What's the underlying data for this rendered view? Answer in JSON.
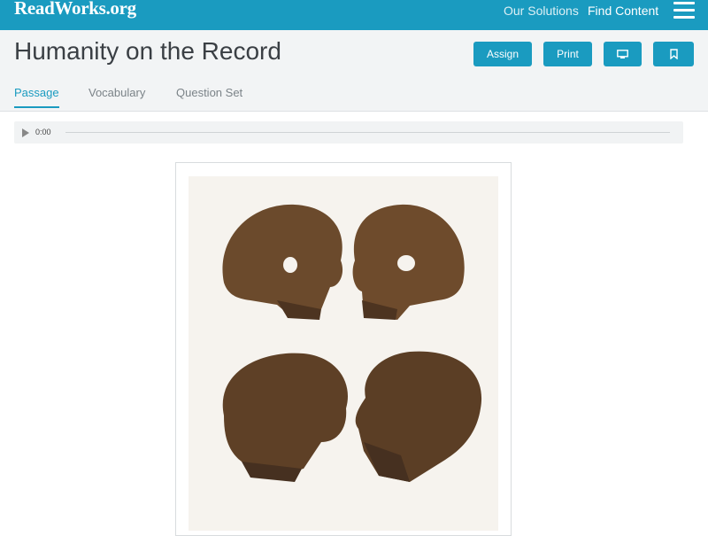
{
  "header": {
    "logo": "ReadWorks.org",
    "nav": {
      "solutions": "Our Solutions",
      "find_content": "Find Content"
    }
  },
  "page": {
    "title": "Humanity on the Record"
  },
  "actions": {
    "assign": "Assign",
    "print": "Print"
  },
  "tabs": [
    {
      "label": "Passage",
      "active": true
    },
    {
      "label": "Vocabulary",
      "active": false
    },
    {
      "label": "Question Set",
      "active": false
    }
  ],
  "audio": {
    "time": "0:00"
  },
  "colors": {
    "brand": "#1a9bc0"
  }
}
